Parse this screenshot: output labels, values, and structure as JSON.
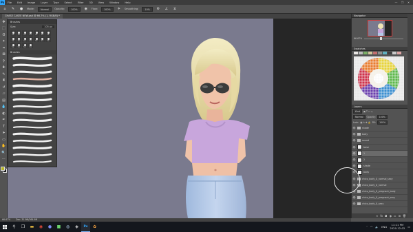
{
  "app": {
    "logo": "Ps",
    "menus": [
      "File",
      "Edit",
      "Image",
      "Layer",
      "Type",
      "Select",
      "Filter",
      "3D",
      "View",
      "Window",
      "Help"
    ],
    "window_controls": [
      "—",
      "❐",
      "✕"
    ]
  },
  "options_bar": {
    "mode_label": "Mode:",
    "mode_value": "Normal",
    "opacity_label": "Opacity:",
    "opacity_value": "100%",
    "flow_label": "Flow:",
    "flow_value": "100%",
    "smoothing_label": "Smoothing:",
    "smoothing_value": "10%"
  },
  "document_tab": {
    "title": "CHASE CASEE NEW.psd @ 66.7% (1, RGB/8) *"
  },
  "brushes_panel": {
    "title": "Brushes",
    "size_label": "Size:",
    "size_value": "105 px",
    "preset_sizes": [
      "30",
      "30",
      "30",
      "25",
      "25",
      "36",
      "25",
      "36",
      "36",
      "32",
      "25",
      "50",
      "25",
      "50",
      "50",
      "50",
      "50",
      "50"
    ],
    "folder_name": "Brushes"
  },
  "navigator": {
    "title": "Navigator",
    "zoom": "66.67%"
  },
  "swatches": {
    "title": "Swatches",
    "recent_colors": [
      "#e9e6e3",
      "#bfbfbf",
      "#7bb066",
      "#d1c79c",
      "#c56f6f",
      "#8e8e8e",
      "#5fb0c0",
      "#404040",
      "#c9c9c9",
      "#dca3a3"
    ]
  },
  "layers": {
    "title": "Layers",
    "search_placeholder": "Kind",
    "blend_mode": "Normal",
    "opacity_label": "Opacity:",
    "opacity_value": "100%",
    "lock_label": "Lock:",
    "fill_label": "Fill:",
    "fill_value": "100%",
    "rows": [
      {
        "name": "shade",
        "type": "folder",
        "selected": false
      },
      {
        "name": "body",
        "type": "folder",
        "selected": false
      },
      {
        "name": "sound",
        "type": "folder",
        "selected": false
      },
      {
        "name": "base",
        "type": "layer",
        "selected": false
      },
      {
        "name": "1",
        "type": "layer",
        "selected": true
      },
      {
        "name": "2",
        "type": "layer",
        "selected": false
      },
      {
        "name": "shade",
        "type": "layer",
        "selected": false
      },
      {
        "name": "body",
        "type": "layer",
        "selected": false
      },
      {
        "name": "chico_body_0_normal_sexy",
        "type": "folder",
        "selected": false
      },
      {
        "name": "chico_body_0_normal",
        "type": "folder",
        "selected": false
      },
      {
        "name": "chico_body_0_pregnant_body",
        "type": "folder",
        "selected": false
      },
      {
        "name": "chico_body_0_pregnant_sexy",
        "type": "folder",
        "selected": false
      },
      {
        "name": "chico_body_0_sexy",
        "type": "folder",
        "selected": false
      }
    ]
  },
  "status_bar": {
    "zoom": "66.67%",
    "doc_info": "Doc: 31.9M/364.9M"
  },
  "taskbar": {
    "time": "11:11 PM",
    "date": "2020-12-02",
    "lang": "ENG"
  }
}
